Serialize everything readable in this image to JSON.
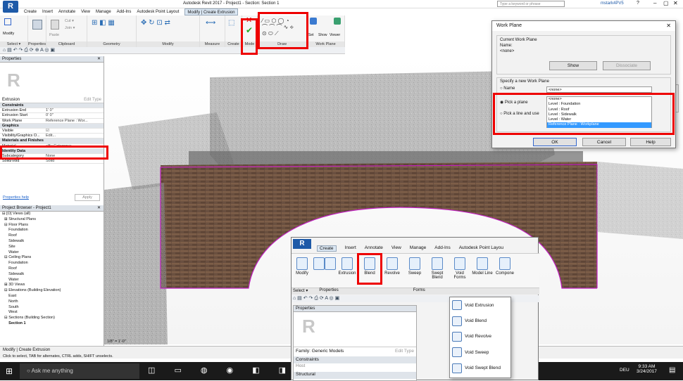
{
  "app": {
    "title": "Autodesk Revit 2017 -   Project1 - Section: Section 1",
    "logo": "R",
    "search_placeholder": "Type a keyword or phrase",
    "user": "mstark4PV5",
    "help": "?"
  },
  "tabs": [
    "Create",
    "Insert",
    "Annotate",
    "View",
    "Manage",
    "Add-Ins",
    "Autodesk Point Layout",
    "Modify | Create Extrusion"
  ],
  "ribbon": {
    "groups": [
      "Select ▾",
      "Properties",
      "Clipboard",
      "Geometry",
      "Modify",
      "Measure",
      "Create",
      "Mode",
      "Draw",
      "Work Plane"
    ],
    "modify_label": "Modify",
    "paste_label": "Paste",
    "cut_label": "Cut ▾",
    "join_label": "Join ▾",
    "set_label": "Set",
    "show_label": "Show",
    "viewer_label": "Viewer"
  },
  "properties": {
    "title": "Properties",
    "type": "Extrusion",
    "edit_type": "Edit Type",
    "rows": [
      {
        "k": "Constraints",
        "v": "",
        "sec": true
      },
      {
        "k": "Extrusion End",
        "v": "1' 0\""
      },
      {
        "k": "Extrusion Start",
        "v": "0' 0\""
      },
      {
        "k": "Work Plane",
        "v": "Reference Plane : Wor..."
      },
      {
        "k": "Graphics",
        "v": "",
        "sec": true
      },
      {
        "k": "Visible",
        "v": "☑"
      },
      {
        "k": "Visibility/Graphics O...",
        "v": "Edit..."
      },
      {
        "k": "Materials and Finishes",
        "v": "",
        "sec": true
      },
      {
        "k": "Material",
        "v": "<By Category>"
      },
      {
        "k": "Identity Data",
        "v": "",
        "sec": true
      },
      {
        "k": "Subcategory",
        "v": "None"
      },
      {
        "k": "Solid/Void",
        "v": "Solid"
      }
    ],
    "help": "Properties help",
    "apply": "Apply"
  },
  "browser": {
    "title": "Project Browser - Project1",
    "items": [
      "⊟ [O] Views (all)",
      "  ⊞ Structural Plans",
      "  ⊟ Floor Plans",
      "      Foundation",
      "      Roof",
      "      Sidewalk",
      "      Site",
      "      Water",
      "  ⊟ Ceiling Plans",
      "      Foundation",
      "      Roof",
      "      Sidewalk",
      "      Water",
      "  ⊞ 3D Views",
      "  ⊟ Elevations (Building Elevation)",
      "      East",
      "      North",
      "      South",
      "      West",
      "  ⊟ Sections (Building Section)",
      "      Section 1"
    ]
  },
  "status": {
    "left": "Modify | Create Extrusion",
    "hint": "Click to select, TAB for alternates, CTRL adds, SHIFT unselects.",
    "scale": "1/8\" = 1'-0\""
  },
  "dialog": {
    "title": "Work Plane",
    "current_label": "Current Work Plane",
    "name_label": "Name:",
    "name_value": "<none>",
    "show": "Show",
    "dissociate": "Dissociate",
    "specify": "Specify a new Work Plane",
    "opt_name": "Name",
    "opt_pick": "Pick a plane",
    "opt_line": "Pick a line and use",
    "combo": "<none>",
    "options": [
      "<none>",
      "Level : Foundation",
      "Level : Roof",
      "Level : Sidewalk",
      "Level : Water",
      "Reference Plane : Workplane"
    ],
    "ok": "OK",
    "cancel": "Cancel",
    "help": "Help"
  },
  "inset": {
    "tabs": [
      "Create",
      "Insert",
      "Annotate",
      "View",
      "Manage",
      "Add-Ins",
      "Autodesk Point Layou"
    ],
    "tools": [
      "Modify",
      "",
      "",
      "Extrusion",
      "Blend",
      "Revolve",
      "Sweep",
      "Swept Blend",
      "Void Forms",
      "Model Line",
      "Compone"
    ],
    "group_select": "Select ▾",
    "group_props": "Properties",
    "group_forms": "Forms",
    "props_title": "Properties",
    "family": "Family: Generic Models",
    "edit_type": "Edit Type",
    "constraints": "Constraints",
    "host": "Host",
    "structural": "Structural"
  },
  "void_menu": [
    "Void Extrusion",
    "Void Blend",
    "Void Revolve",
    "Void Sweep",
    "Void Swept Blend"
  ],
  "taskbar": {
    "search": "Ask me anything",
    "lang": "DEU",
    "time": "9:33 AM",
    "date": "3/24/2017"
  },
  "colors": {
    "revit_blue": "#1e5aa8",
    "highlight": "#e00000",
    "selection": "#3399ff",
    "magenta": "#c020c0"
  }
}
